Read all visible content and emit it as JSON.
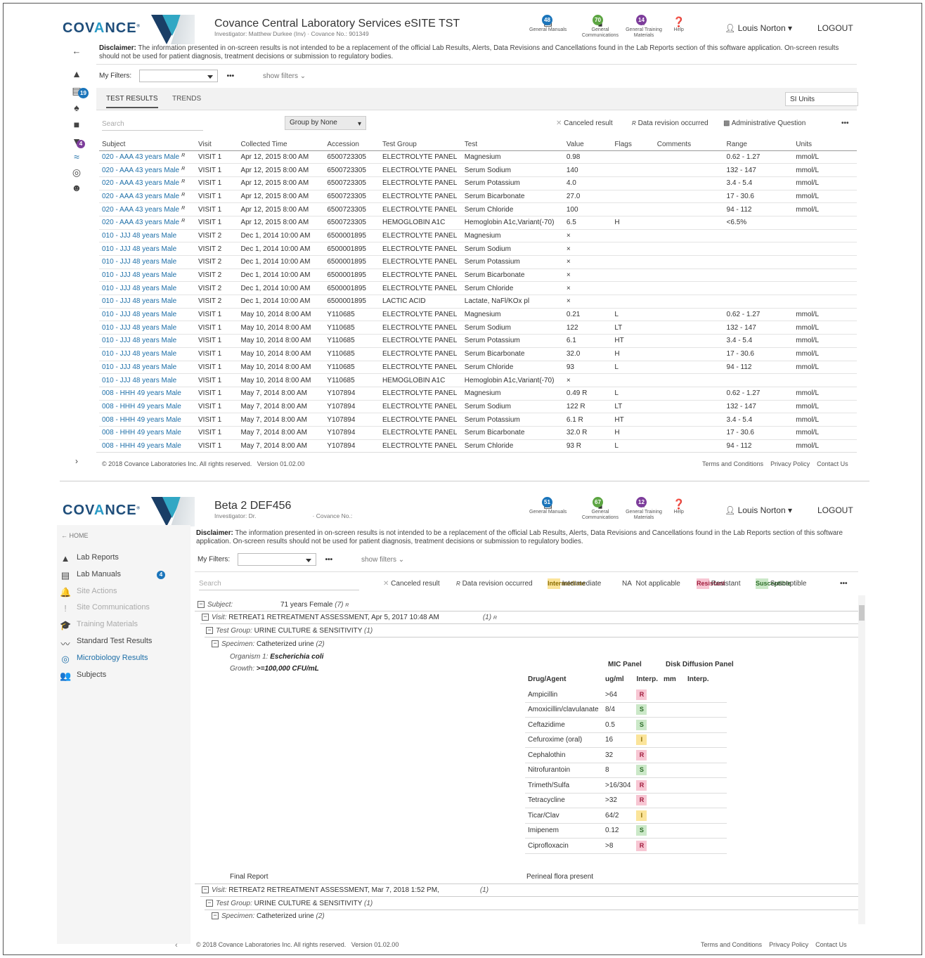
{
  "p1": {
    "brand": "COVANCE",
    "title": "Covance Central Laboratory Services eSITE TST",
    "subtitle": "Investigator: Matthew Durkee (Inv) · Covance No.: 901349",
    "header_icons": [
      {
        "name": "General Manuals",
        "badge": "48",
        "color": "#1b75bb"
      },
      {
        "name": "General Communications",
        "badge": "70",
        "color": "#5ca542"
      },
      {
        "name": "General Training Materials",
        "badge": "14",
        "color": "#7d3d9b"
      },
      {
        "name": "Help",
        "badge": ""
      }
    ],
    "user": "Louis Norton",
    "logout": "LOGOUT",
    "disclaimer_label": "Disclaimer:",
    "disclaimer": "The information presented in on-screen results is not intended to be a replacement of the official Lab Results, Alerts, Data Revisions and Cancellations found in the Lab Reports section of this software application. On-screen results should not be used for patient diagnosis, treatment decisions or submission to regulatory bodies.",
    "my_filters": "My Filters:",
    "show_filters": "show filters",
    "more": "•••",
    "sidebar_badges": {
      "manuals": "19",
      "training": "4"
    },
    "tabs": [
      "TEST RESULTS",
      "TRENDS"
    ],
    "units": "SI Units",
    "search_placeholder": "Search",
    "group_by": "Group by None",
    "legend": {
      "canceled": "Canceled result",
      "revision": "Data revision occurred",
      "admin": "Administrative Question"
    },
    "columns": [
      "Subject",
      "Visit",
      "Collected Time",
      "Accession",
      "Test Group",
      "Test",
      "Value",
      "Flags",
      "Comments",
      "Range",
      "Units"
    ],
    "rows": [
      [
        "020 - AAA 43 years Male",
        "R",
        "VISIT 1",
        "Apr 12, 2015 8:00 AM",
        "6500723305",
        "ELECTROLYTE PANEL",
        "Magnesium",
        "0.98",
        "",
        "",
        "0.62 - 1.27",
        "mmol/L"
      ],
      [
        "020 - AAA 43 years Male",
        "R",
        "VISIT 1",
        "Apr 12, 2015 8:00 AM",
        "6500723305",
        "ELECTROLYTE PANEL",
        "Serum Sodium",
        "140",
        "",
        "",
        "132 - 147",
        "mmol/L"
      ],
      [
        "020 - AAA 43 years Male",
        "R",
        "VISIT 1",
        "Apr 12, 2015 8:00 AM",
        "6500723305",
        "ELECTROLYTE PANEL",
        "Serum Potassium",
        "4.0",
        "",
        "",
        "3.4 - 5.4",
        "mmol/L"
      ],
      [
        "020 - AAA 43 years Male",
        "R",
        "VISIT 1",
        "Apr 12, 2015 8:00 AM",
        "6500723305",
        "ELECTROLYTE PANEL",
        "Serum Bicarbonate",
        "27.0",
        "",
        "",
        "17 - 30.6",
        "mmol/L"
      ],
      [
        "020 - AAA 43 years Male",
        "R",
        "VISIT 1",
        "Apr 12, 2015 8:00 AM",
        "6500723305",
        "ELECTROLYTE PANEL",
        "Serum Chloride",
        "100",
        "",
        "",
        "94 - 112",
        "mmol/L"
      ],
      [
        "020 - AAA 43 years Male",
        "R",
        "VISIT 1",
        "Apr 12, 2015 8:00 AM",
        "6500723305",
        "HEMOGLOBIN A1C",
        "Hemoglobin A1c,Variant(-70)",
        "6.5",
        "H",
        "",
        "<6.5%",
        ""
      ],
      [
        "010 - JJJ 48 years Male",
        "",
        "VISIT 2",
        "Dec 1, 2014 10:00 AM",
        "6500001895",
        "ELECTROLYTE PANEL",
        "Magnesium",
        "×",
        "",
        "",
        "",
        ""
      ],
      [
        "010 - JJJ 48 years Male",
        "",
        "VISIT 2",
        "Dec 1, 2014 10:00 AM",
        "6500001895",
        "ELECTROLYTE PANEL",
        "Serum Sodium",
        "×",
        "",
        "",
        "",
        ""
      ],
      [
        "010 - JJJ 48 years Male",
        "",
        "VISIT 2",
        "Dec 1, 2014 10:00 AM",
        "6500001895",
        "ELECTROLYTE PANEL",
        "Serum Potassium",
        "×",
        "",
        "",
        "",
        ""
      ],
      [
        "010 - JJJ 48 years Male",
        "",
        "VISIT 2",
        "Dec 1, 2014 10:00 AM",
        "6500001895",
        "ELECTROLYTE PANEL",
        "Serum Bicarbonate",
        "×",
        "",
        "",
        "",
        ""
      ],
      [
        "010 - JJJ 48 years Male",
        "",
        "VISIT 2",
        "Dec 1, 2014 10:00 AM",
        "6500001895",
        "ELECTROLYTE PANEL",
        "Serum Chloride",
        "×",
        "",
        "",
        "",
        ""
      ],
      [
        "010 - JJJ 48 years Male",
        "",
        "VISIT 2",
        "Dec 1, 2014 10:00 AM",
        "6500001895",
        "LACTIC ACID",
        "Lactate, NaFl/KOx pl",
        "×",
        "",
        "",
        "",
        ""
      ],
      [
        "010 - JJJ 48 years Male",
        "",
        "VISIT 1",
        "May 10, 2014 8:00 AM",
        "Y110685",
        "ELECTROLYTE PANEL",
        "Magnesium",
        "0.21",
        "L",
        "",
        "0.62 - 1.27",
        "mmol/L"
      ],
      [
        "010 - JJJ 48 years Male",
        "",
        "VISIT 1",
        "May 10, 2014 8:00 AM",
        "Y110685",
        "ELECTROLYTE PANEL",
        "Serum Sodium",
        "122",
        "LT",
        "",
        "132 - 147",
        "mmol/L"
      ],
      [
        "010 - JJJ 48 years Male",
        "",
        "VISIT 1",
        "May 10, 2014 8:00 AM",
        "Y110685",
        "ELECTROLYTE PANEL",
        "Serum Potassium",
        "6.1",
        "HT",
        "",
        "3.4 - 5.4",
        "mmol/L"
      ],
      [
        "010 - JJJ 48 years Male",
        "",
        "VISIT 1",
        "May 10, 2014 8:00 AM",
        "Y110685",
        "ELECTROLYTE PANEL",
        "Serum Bicarbonate",
        "32.0",
        "H",
        "",
        "17 - 30.6",
        "mmol/L"
      ],
      [
        "010 - JJJ 48 years Male",
        "",
        "VISIT 1",
        "May 10, 2014 8:00 AM",
        "Y110685",
        "ELECTROLYTE PANEL",
        "Serum Chloride",
        "93",
        "L",
        "",
        "94 - 112",
        "mmol/L"
      ],
      [
        "010 - JJJ 48 years Male",
        "",
        "VISIT 1",
        "May 10, 2014 8:00 AM",
        "Y110685",
        "HEMOGLOBIN A1C",
        "Hemoglobin A1c,Variant(-70)",
        "×",
        "",
        "",
        "",
        ""
      ],
      [
        "008 - HHH 49 years Male",
        "",
        "VISIT 1",
        "May 7, 2014 8:00 AM",
        "Y107894",
        "ELECTROLYTE PANEL",
        "Magnesium",
        "0.49 R",
        "L",
        "",
        "0.62 - 1.27",
        "mmol/L"
      ],
      [
        "008 - HHH 49 years Male",
        "",
        "VISIT 1",
        "May 7, 2014 8:00 AM",
        "Y107894",
        "ELECTROLYTE PANEL",
        "Serum Sodium",
        "122 R",
        "LT",
        "",
        "132 - 147",
        "mmol/L"
      ],
      [
        "008 - HHH 49 years Male",
        "",
        "VISIT 1",
        "May 7, 2014 8:00 AM",
        "Y107894",
        "ELECTROLYTE PANEL",
        "Serum Potassium",
        "6.1 R",
        "HT",
        "",
        "3.4 - 5.4",
        "mmol/L"
      ],
      [
        "008 - HHH 49 years Male",
        "",
        "VISIT 1",
        "May 7, 2014 8:00 AM",
        "Y107894",
        "ELECTROLYTE PANEL",
        "Serum Bicarbonate",
        "32.0 R",
        "H",
        "",
        "17 - 30.6",
        "mmol/L"
      ],
      [
        "008 - HHH 49 years Male",
        "",
        "VISIT 1",
        "May 7, 2014 8:00 AM",
        "Y107894",
        "ELECTROLYTE PANEL",
        "Serum Chloride",
        "93 R",
        "L",
        "",
        "94 - 112",
        "mmol/L"
      ]
    ],
    "copyright": "© 2018 Covance Laboratories Inc. All rights reserved.",
    "version": "Version 01.02.00",
    "footer_links": [
      "Terms and Conditions",
      "Privacy Policy",
      "Contact Us"
    ]
  },
  "p2": {
    "title": "Beta 2 DEF456",
    "subtitle_investigator": "Investigator: Dr.",
    "subtitle_covance": "· Covance No.:",
    "header_icons": [
      {
        "name": "General Manuals",
        "badge": "51",
        "color": "#1b75bb"
      },
      {
        "name": "General Communications",
        "badge": "67",
        "color": "#5ca542"
      },
      {
        "name": "General Training Materials",
        "badge": "12",
        "color": "#7d3d9b"
      },
      {
        "name": "Help",
        "badge": ""
      }
    ],
    "user": "Louis Norton",
    "logout": "LOGOUT",
    "home": "← HOME",
    "nav": [
      {
        "label": "Lab Reports",
        "icon": "▲",
        "state": "normal"
      },
      {
        "label": "Lab Manuals",
        "icon": "▤",
        "state": "normal",
        "badge": "4"
      },
      {
        "label": "Site Actions",
        "icon": "🔔",
        "state": "dim"
      },
      {
        "label": "Site Communications",
        "icon": "!",
        "state": "dim"
      },
      {
        "label": "Training Materials",
        "icon": "🎓",
        "state": "dim"
      },
      {
        "label": "Standard Test Results",
        "icon": "〰",
        "state": "normal"
      },
      {
        "label": "Microbiology Results",
        "icon": "◎",
        "state": "link"
      },
      {
        "label": "Subjects",
        "icon": "👥",
        "state": "normal"
      }
    ],
    "disclaimer_label": "Disclaimer:",
    "disclaimer": "The information presented in on-screen results is not intended to be a replacement of the official Lab Results, Alerts, Data Revisions and Cancellations found in the Lab Reports section of this software application. On-screen results should not be used for patient diagnosis, treatment decisions or submission to regulatory bodies.",
    "my_filters": "My Filters:",
    "show_filters": "show filters",
    "more": "•••",
    "search_placeholder": "Search",
    "legend": {
      "canceled": "Canceled result",
      "revision": "Data revision occurred",
      "I": "Intermediate",
      "NA": "NA",
      "na_label": "Not applicable",
      "R": "Resistant",
      "S": "Susceptible"
    },
    "tree": {
      "subject_label": "Subject:",
      "subject": "71 years Female",
      "subject_count": "(7)",
      "visit_label": "Visit:",
      "visit1": "RETREAT1 RETREATMENT ASSESSMENT, Apr 5, 2017 10:48 AM",
      "visit1_count": "(1)",
      "tg_label": "Test Group:",
      "testgroup": "URINE CULTURE & SENSITIVITY",
      "tg_count": "(1)",
      "sp_label": "Specimen:",
      "specimen": "Catheterized urine",
      "sp_count": "(2)",
      "org_label": "Organism 1:",
      "organism": "Escherichia coli",
      "growth_label": "Growth:",
      "growth": ">=100,000 CFU/mL",
      "final_report": "Final Report",
      "perineal": "Perineal flora present",
      "visit2": "RETREAT2 RETREATMENT ASSESSMENT, Mar 7, 2018 1:52 PM,",
      "visit2_count": "(1)"
    },
    "mic": {
      "panel1": "MIC Panel",
      "panel2": "Disk Diffusion Panel",
      "headers": [
        "Drug/Agent",
        "ug/ml",
        "Interp.",
        "mm",
        "Interp."
      ],
      "rows": [
        [
          "Ampicillin",
          ">64",
          "R"
        ],
        [
          "Amoxicillin/clavulanate",
          "8/4",
          "S"
        ],
        [
          "Ceftazidime",
          "0.5",
          "S"
        ],
        [
          "Cefuroxime (oral)",
          "16",
          "I"
        ],
        [
          "Cephalothin",
          "32",
          "R"
        ],
        [
          "Nitrofurantoin",
          "8",
          "S"
        ],
        [
          "Trimeth/Sulfa",
          ">16/304",
          "R"
        ],
        [
          "Tetracycline",
          ">32",
          "R"
        ],
        [
          "Ticar/Clav",
          "64/2",
          "I"
        ],
        [
          "Imipenem",
          "0.12",
          "S"
        ],
        [
          "Ciprofloxacin",
          ">8",
          "R"
        ]
      ]
    },
    "copyright": "© 2018 Covance Laboratories Inc. All rights reserved.",
    "version": "Version 01.02.00",
    "footer_links": [
      "Terms and Conditions",
      "Privacy Policy",
      "Contact Us"
    ]
  }
}
